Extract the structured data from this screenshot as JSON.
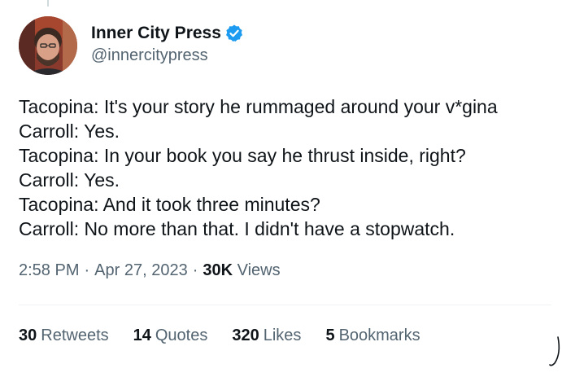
{
  "author": {
    "display_name": "Inner City Press",
    "handle": "@innercitypress",
    "verified": true,
    "avatar_icon": "user-photo-avatar"
  },
  "tweet": {
    "lines": [
      "Tacopina: It's your story he rummaged around your v*gina",
      "Carroll: Yes.",
      "Tacopina: In your book you say he thrust inside, right?",
      "Carroll: Yes.",
      "Tacopina: And it took three minutes?",
      "Carroll: No more than that. I didn't have a stopwatch."
    ],
    "time": "2:58 PM",
    "date": "Apr 27, 2023",
    "views_count": "30K",
    "views_label": "Views"
  },
  "stats": [
    {
      "count": "30",
      "label": "Retweets"
    },
    {
      "count": "14",
      "label": "Quotes"
    },
    {
      "count": "320",
      "label": "Likes"
    },
    {
      "count": "5",
      "label": "Bookmarks"
    }
  ],
  "colors": {
    "text_primary": "#0f1419",
    "text_secondary": "#536471",
    "verified_blue": "#1d9bf0",
    "divider": "#eff3f4"
  }
}
